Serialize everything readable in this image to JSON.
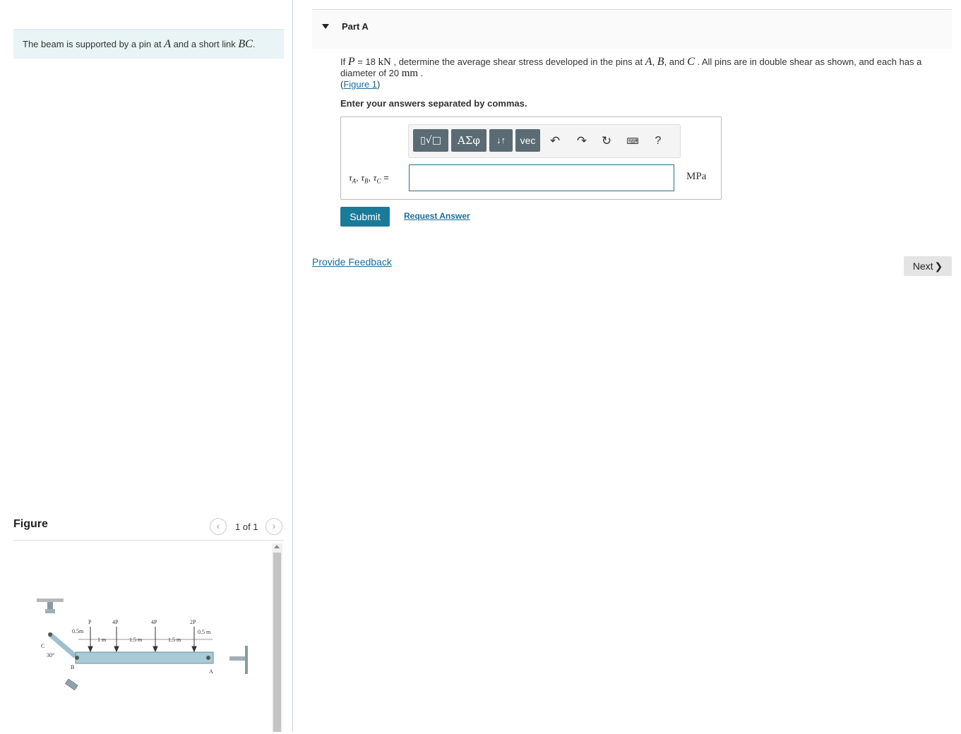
{
  "intro": {
    "text_before": "The beam is supported by a pin at ",
    "var_a": "A",
    "text_middle": " and a short link ",
    "var_bc": "BC",
    "text_after": "."
  },
  "figure_panel": {
    "title": "Figure",
    "pager_text": "1 of 1",
    "labels": {
      "P": "P",
      "fourP_1": "4P",
      "fourP_2": "4P",
      "twoP": "2P",
      "half_m_left": "0.5m",
      "one_m": "1 m",
      "one_five_1": "1.5 m",
      "one_five_2": "1.5 m",
      "half_m_right": "0.5 m",
      "C": "C",
      "B": "B",
      "A": "A",
      "angle": "30°"
    }
  },
  "part": {
    "title": "Part A",
    "q_if": "If ",
    "q_p": "P",
    "q_eq": " = 18 ",
    "q_kn": "kN",
    "q_text1": " , determine the average shear stress developed in the pins at ",
    "q_a": "A",
    "q_comma1": ", ",
    "q_b": "B",
    "q_and": ", and ",
    "q_c": "C",
    "q_text2": " . All pins are in double shear as shown, and each has a diameter of 20 ",
    "q_mm": "mm",
    "q_end": " .",
    "figure_link_open": "(",
    "figure_link": "Figure 1",
    "figure_link_close": ")",
    "instruction": "Enter your answers separated by commas."
  },
  "answer": {
    "label_tau_a": "τ",
    "sub_a": "A",
    "label_tau_b": "τ",
    "sub_b": "B",
    "label_tau_c": "τ",
    "sub_c": "C",
    "label_sep": ", ",
    "label_eq": " =",
    "input_value": "",
    "unit": "MPa",
    "toolbar": {
      "greek": "ΑΣφ",
      "arrows": "↓↑",
      "vec": "vec",
      "undo": "↶",
      "redo": "↷",
      "reset": "↻",
      "keyboard": "⌨",
      "help": "?"
    }
  },
  "actions": {
    "submit": "Submit",
    "request_answer": "Request Answer",
    "feedback": "Provide Feedback",
    "next": "Next",
    "next_chevron": "❯"
  }
}
